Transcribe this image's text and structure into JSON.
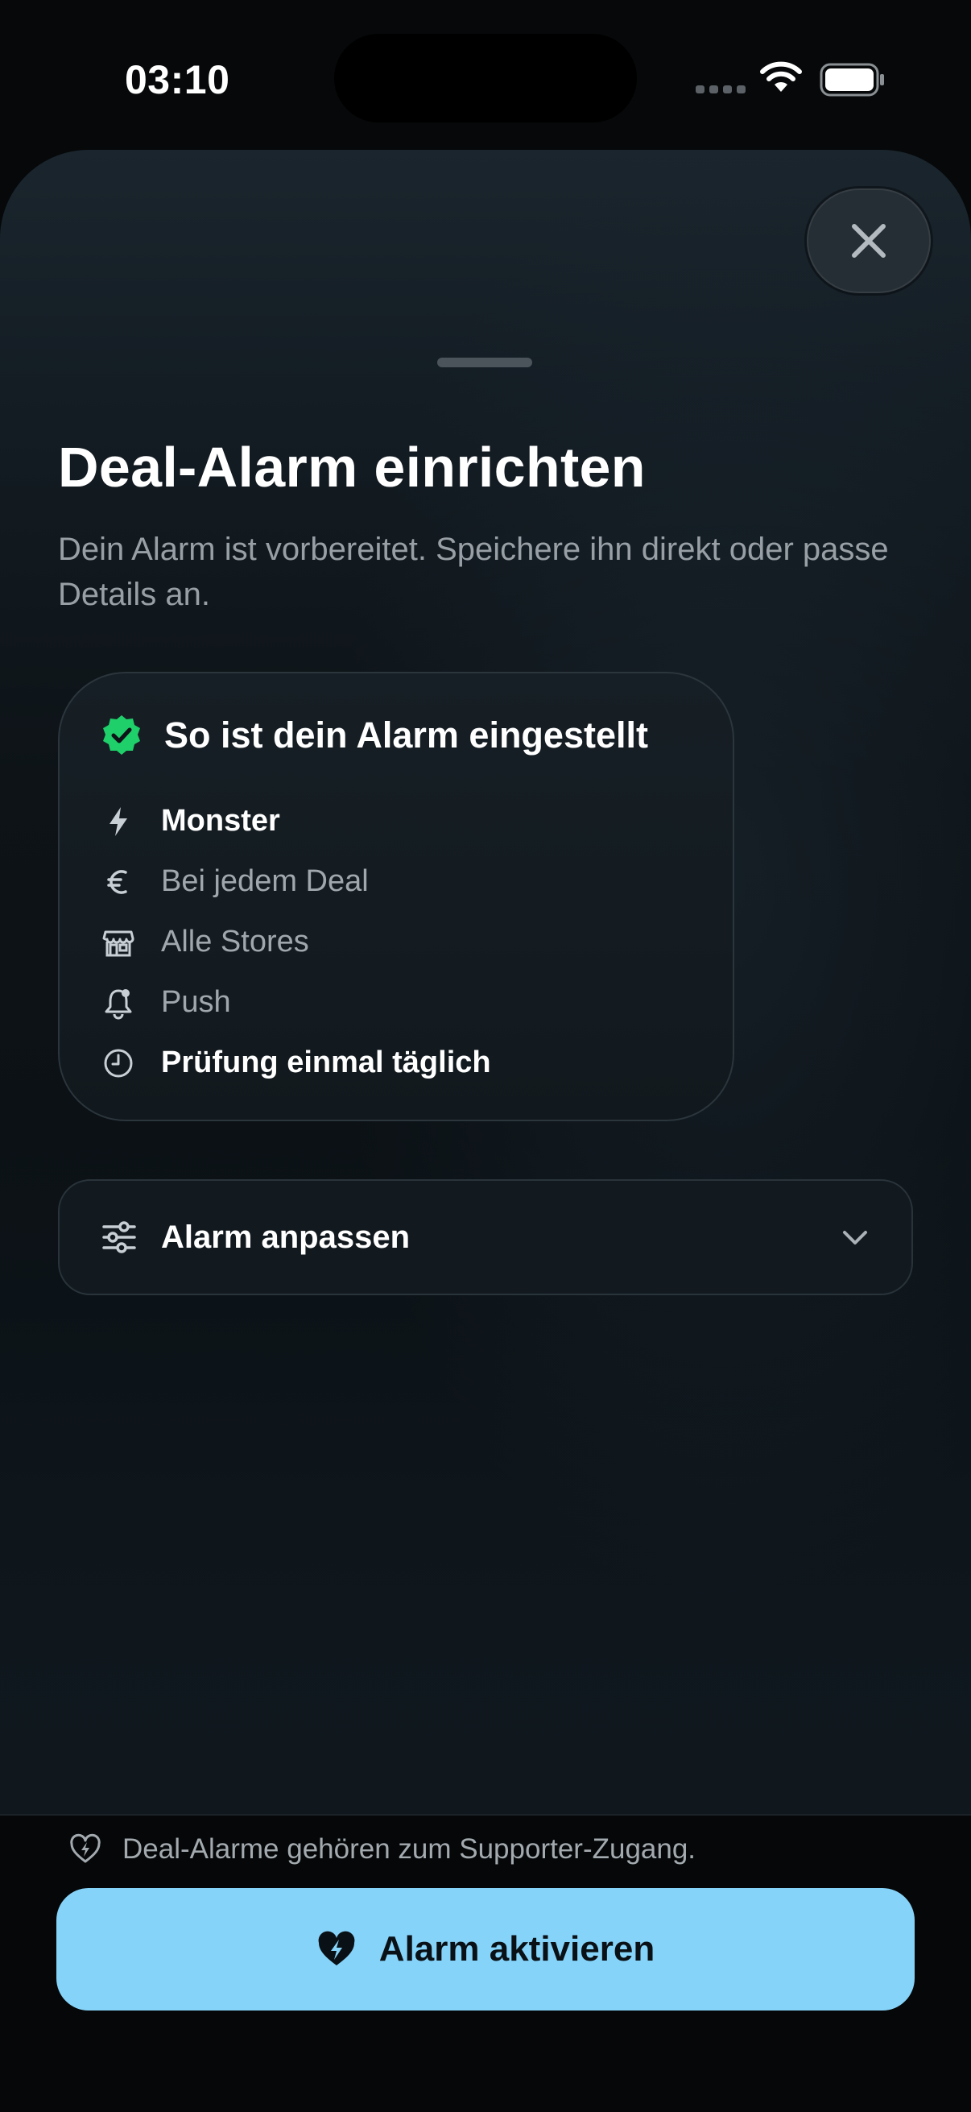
{
  "status_bar": {
    "time": "03:10"
  },
  "sheet": {
    "title": "Deal-Alarm einrichten",
    "subtitle": "Dein Alarm ist vorbereitet. Speichere ihn direkt oder passe Details an."
  },
  "summary": {
    "title": "So ist dein Alarm eingestellt",
    "rows": [
      {
        "icon": "bolt-icon",
        "label": "Monster"
      },
      {
        "icon": "euro-icon",
        "label": "Bei jedem Deal"
      },
      {
        "icon": "store-icon",
        "label": "Alle Stores"
      },
      {
        "icon": "bell-icon",
        "label": "Push"
      },
      {
        "icon": "clock-icon",
        "label": "Prüfung einmal täglich"
      }
    ]
  },
  "customize": {
    "label": "Alarm anpassen"
  },
  "footer": {
    "note": "Deal-Alarme gehören zum Supporter-Zugang.",
    "cta_label": "Alarm aktivieren"
  },
  "colors": {
    "accent": "#86d3f9",
    "success": "#1fcf6a",
    "sheet_bg": "#0d1317"
  }
}
